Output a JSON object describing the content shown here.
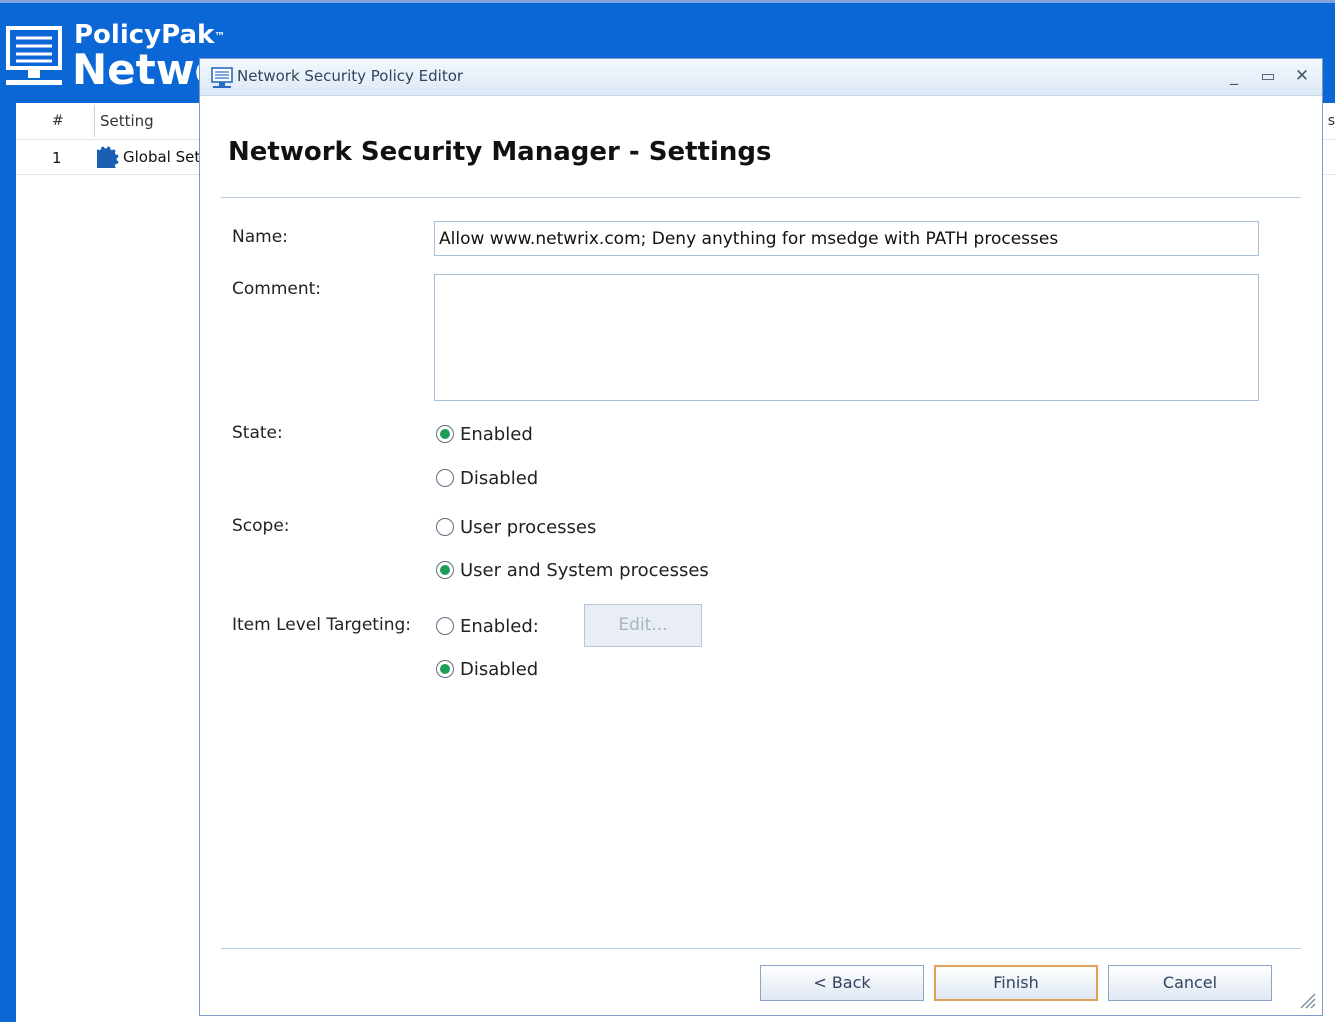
{
  "background_app": {
    "brand": "PolicyPak",
    "trademark": "™",
    "product": "Network Security Manager",
    "grid": {
      "columns": [
        "#",
        "Setting"
      ],
      "right_header_fragment": "s",
      "rows": [
        {
          "num": "1",
          "setting": "Global Settings"
        }
      ]
    }
  },
  "dialog": {
    "title": "Network Security Policy Editor",
    "heading": "Network Security Manager - Settings",
    "window_buttons": {
      "minimize": "minimize-icon",
      "maximize": "maximize-icon",
      "close": "close-icon"
    },
    "fields": {
      "name_label": "Name:",
      "name_value": "Allow www.netwrix.com; Deny anything for msedge with PATH processes",
      "comment_label": "Comment:",
      "comment_value": ""
    },
    "state": {
      "label": "State:",
      "options": [
        "Enabled",
        "Disabled"
      ],
      "selected": "Enabled"
    },
    "scope": {
      "label": "Scope:",
      "options": [
        "User processes",
        "User and System processes"
      ],
      "selected": "User and System processes"
    },
    "item_level_targeting": {
      "label": "Item Level Targeting:",
      "options": [
        "Enabled:",
        "Disabled"
      ],
      "selected": "Disabled",
      "edit_button": "Edit..."
    },
    "buttons": {
      "back": "<  Back",
      "finish": "Finish",
      "cancel": "Cancel"
    }
  },
  "colors": {
    "background_blue": "#0b66d6",
    "radio_checked": "#1e9d55",
    "finish_border": "#e0a35a",
    "title_text": "#30445e"
  }
}
